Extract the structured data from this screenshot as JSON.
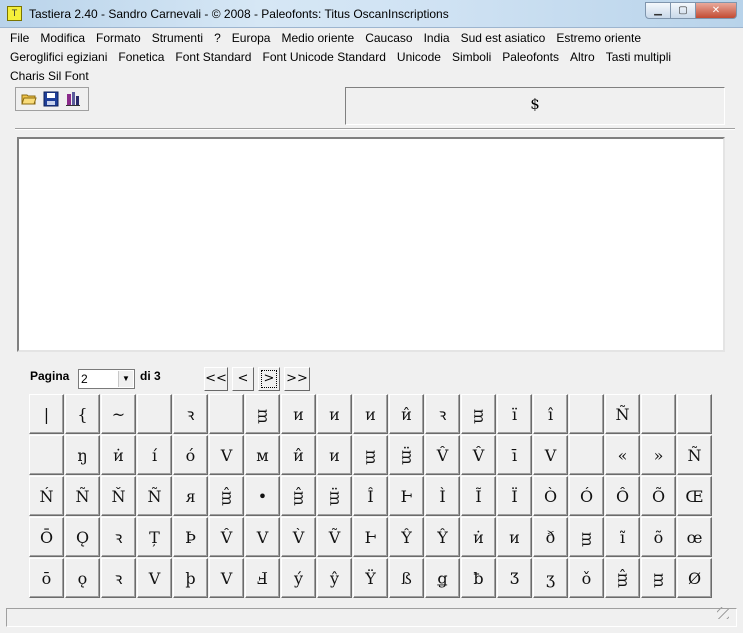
{
  "window": {
    "title": "Tastiera 2.40 - Sandro Carnevali - ©  2008 - Paleofonts: Titus OscanInscriptions",
    "icon": "app-icon",
    "buttons": {
      "minimize": "minimize-icon",
      "maximize": "maximize-icon",
      "close": "close-icon"
    }
  },
  "menu": [
    "File",
    "Modifica",
    "Formato",
    "Strumenti",
    "?",
    "Europa",
    "Medio oriente",
    "Caucaso",
    "India",
    "Sud est asiatico",
    "Estremo oriente",
    "Geroglifici egiziani",
    "Fonetica",
    "Font Standard",
    "Font Unicode Standard",
    "Unicode",
    "Simboli",
    "Paleofonts",
    "Altro",
    "Tasti multipli",
    "Charis Sil Font"
  ],
  "toolbar": {
    "open": "open-folder-icon",
    "save": "save-disk-icon",
    "tool": "character-tool-icon"
  },
  "selected_char": "$",
  "text_area": {
    "value": ""
  },
  "pager": {
    "label": "Pagina",
    "value": "2",
    "of_label": "di",
    "total": "3",
    "first": "<<",
    "prev": "<",
    "next": ">",
    "last": ">>"
  },
  "keys": [
    [
      "|",
      "{",
      "~",
      "",
      "ꝛ",
      "",
      "ᴟ",
      "ᴎ",
      "ᴎ",
      "ᴎ",
      "ᴎ̂",
      "ꝛ",
      "ᴟ",
      "ï",
      "î",
      "",
      "Ñ",
      "",
      ""
    ],
    [
      "",
      "ŋ",
      "ᴎ̇",
      "í",
      "ó",
      "V",
      "ᴍ",
      "ᴎ̂",
      "ᴎ",
      "ᴟ",
      "ᴟ̈",
      "V̂",
      "V̂",
      "ī",
      "V",
      "",
      "«",
      "»",
      "Ñ"
    ],
    [
      "Ń",
      "Ñ",
      "Ň",
      "Ñ",
      "ᴙ",
      "ᴟ̂",
      "•",
      "ᴟ̂",
      "ᴟ̈",
      "Î",
      "Ⱶ",
      "Ì",
      "Ĩ",
      "Ï",
      "Ò",
      "Ó",
      "Ô",
      "Õ",
      "Œ"
    ],
    [
      "Ō",
      "Ǫ",
      "ꝛ",
      "Ț",
      "Þ",
      "V̂",
      "V",
      "V̀",
      "Ṽ",
      "Ⱶ",
      "Ŷ",
      "Ŷ",
      "ᴎ̇",
      "ᴎ",
      "ð",
      "ᴟ",
      "ĩ",
      "õ",
      "œ"
    ],
    [
      "ō",
      "ǫ",
      "ꝛ",
      "V",
      "þ",
      "V",
      "Ⅎ",
      "ý",
      "ŷ",
      "Ÿ",
      "ß",
      "ǥ",
      "ƀ",
      "Ʒ",
      "ʒ",
      "ǒ",
      "ᴟ̂",
      "ᴟ",
      "Ø"
    ]
  ]
}
